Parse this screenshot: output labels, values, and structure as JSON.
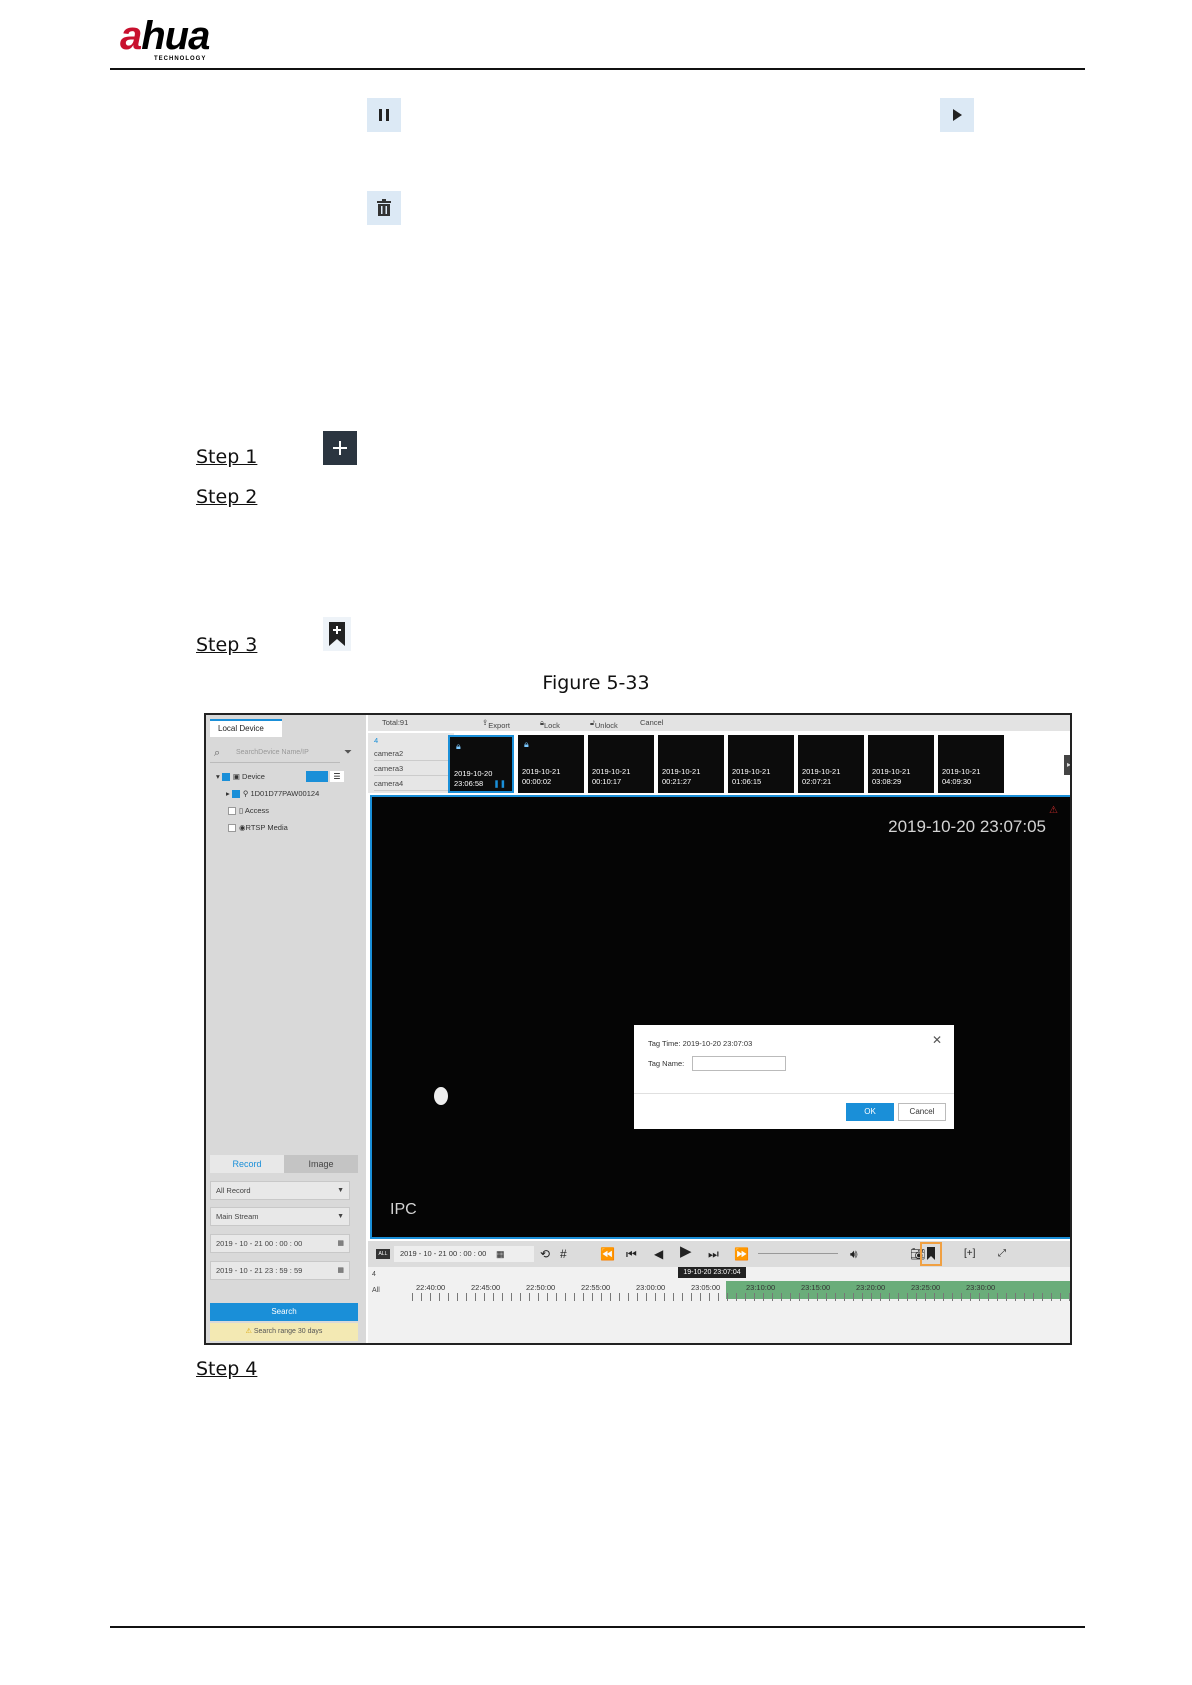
{
  "header": {
    "logo_text_a": "a",
    "logo_text_rest": "hua",
    "logo_sub": "TECHNOLOGY"
  },
  "doc_icons": {
    "pause": "pause-icon",
    "play": "play-icon",
    "delete": "trash-icon",
    "add": "plus-icon",
    "tag": "bookmark-icon"
  },
  "steps": [
    "Step 1",
    "Step 2",
    "Step 3",
    "Step 4"
  ],
  "figure_caption": "Figure 5-33",
  "app": {
    "left_tab": "Local Device",
    "search_placeholder": "SearchDevice Name/IP",
    "tree": {
      "device": "Device",
      "device_id": "1D01D77PAW00124",
      "access": "Access",
      "rtsp": "RTSP Media"
    },
    "record_tabs": [
      "Record",
      "Image"
    ],
    "selects": [
      "All Record",
      "Main Stream"
    ],
    "start_time": "2019 - 10 - 21  00 : 00 : 00",
    "end_time": "2019 - 10 - 21  23 : 59 : 59",
    "search_button": "Search",
    "search_range": "Search range 30 days",
    "toolbar": {
      "total": "Total:91",
      "export": "Export",
      "lock": "Lock",
      "unlock": "Unlock",
      "cancel": "Cancel"
    },
    "camera_list": [
      "4",
      "camera2",
      "camera3",
      "camera4"
    ],
    "thumbnails": [
      {
        "date": "2019-10-20",
        "time": "23:06:58",
        "locked": true
      },
      {
        "date": "2019-10-21",
        "time": "00:00:02",
        "locked": true
      },
      {
        "date": "2019-10-21",
        "time": "00:10:17",
        "locked": false
      },
      {
        "date": "2019-10-21",
        "time": "00:21:27",
        "locked": false
      },
      {
        "date": "2019-10-21",
        "time": "01:06:15",
        "locked": false
      },
      {
        "date": "2019-10-21",
        "time": "02:07:21",
        "locked": false
      },
      {
        "date": "2019-10-21",
        "time": "03:08:29",
        "locked": false
      },
      {
        "date": "2019-10-21",
        "time": "04:09:30",
        "locked": false
      }
    ],
    "video_timestamp": "2019-10-20 23:07:05",
    "video_label": "IPC",
    "dialog": {
      "tag_time": "Tag Time: 2019-10-20 23:07:03",
      "tag_name_label": "Tag Name:",
      "ok": "OK",
      "cancel": "Cancel"
    },
    "control": {
      "all_tag": "ALL",
      "date": "2019 - 10 - 21  00 : 00 : 00"
    },
    "timeline": {
      "row_labels": [
        "4",
        "All"
      ],
      "current": "19-10-20  23:07:04",
      "ticks": [
        "22:40:00",
        "22:45:00",
        "22:50:00",
        "22:55:00",
        "23:00:00",
        "23:05:00",
        "23:10:00",
        "23:15:00",
        "23:20:00",
        "23:25:00",
        "23:30:00"
      ]
    }
  },
  "colors": {
    "accent": "#1a8fd8",
    "highlight": "#f0a042",
    "brand_red": "#c8102e",
    "recording_green": "#6aad7a"
  }
}
